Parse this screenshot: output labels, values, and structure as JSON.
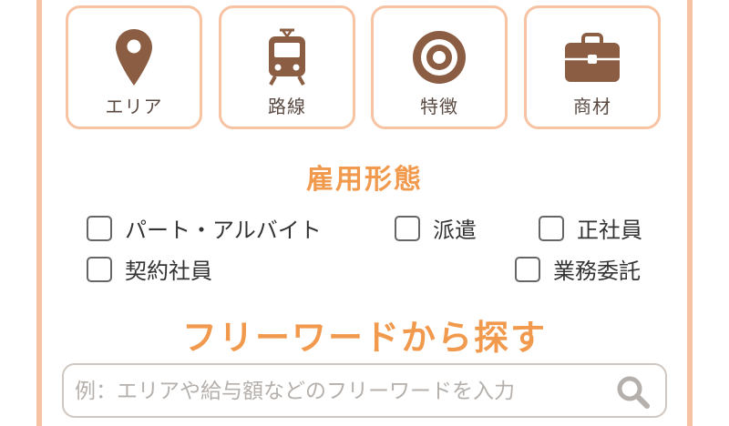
{
  "categories": [
    {
      "label": "エリア",
      "icon": "map-pin-icon"
    },
    {
      "label": "路線",
      "icon": "train-icon"
    },
    {
      "label": "特徴",
      "icon": "target-icon"
    },
    {
      "label": "商材",
      "icon": "briefcase-icon"
    }
  ],
  "employment": {
    "title": "雇用形態",
    "options": [
      "パート・アルバイト",
      "派遣",
      "正社員",
      "契約社員",
      "業務委託"
    ]
  },
  "freeword": {
    "title": "フリーワードから探す",
    "placeholder": "例：エリアや給与額などのフリーワードを入力",
    "value": ""
  },
  "colors": {
    "accent": "#f19a4e",
    "border": "#f7c3a2",
    "icon": "#8b5e44"
  }
}
